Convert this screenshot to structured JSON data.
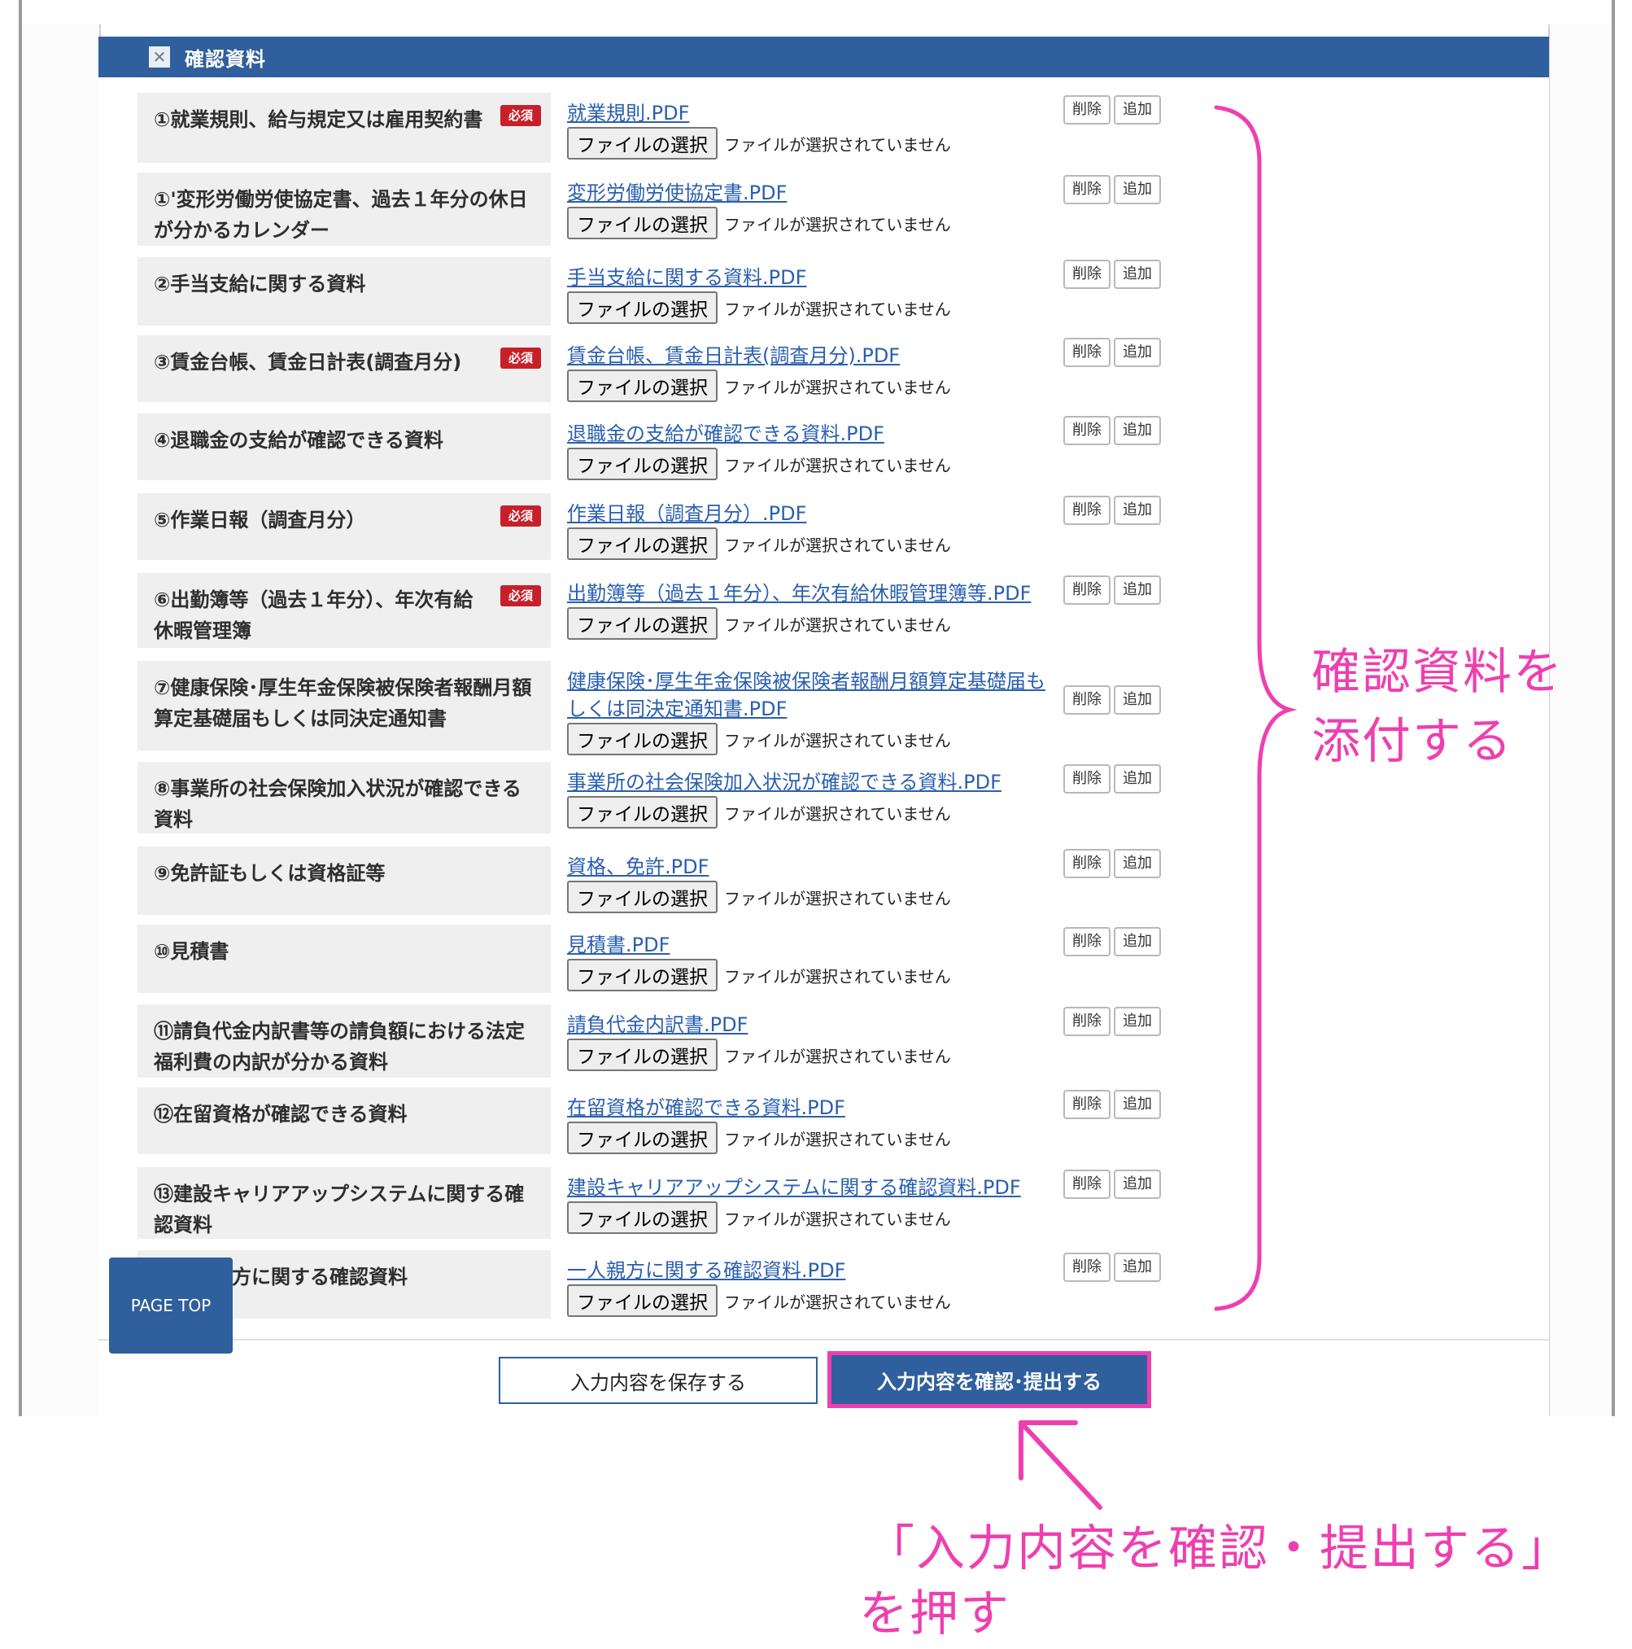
{
  "section": {
    "title": "確認資料",
    "icon": "close-icon"
  },
  "rows": [
    {
      "label": "①就業規則、給与規定又は雇用契約書",
      "required": true,
      "file": "就業規則.PDF"
    },
    {
      "label": "①'変形労働労使協定書、過去１年分の休日が分かるカレンダー",
      "required": false,
      "file": "変形労働労使協定書.PDF"
    },
    {
      "label": "②手当支給に関する資料",
      "required": false,
      "file": "手当支給に関する資料.PDF"
    },
    {
      "label": "③賃金台帳、賃金日計表(調査月分)",
      "required": true,
      "file": "賃金台帳、賃金日計表(調査月分).PDF"
    },
    {
      "label": "④退職金の支給が確認できる資料",
      "required": false,
      "file": "退職金の支給が確認できる資料.PDF"
    },
    {
      "label": "⑤作業日報（調査月分）",
      "required": true,
      "file": "作業日報（調査月分）.PDF"
    },
    {
      "label": "⑥出勤簿等（過去１年分）、年次有給休暇管理簿",
      "required": true,
      "file": "出勤簿等（過去１年分）、年次有給休暇管理簿等.PDF"
    },
    {
      "label": "⑦健康保険･厚生年金保険被保険者報酬月額算定基礎届もしくは同決定通知書",
      "required": false,
      "file": "健康保険･厚生年金保険被保険者報酬月額算定基礎届もしくは同決定通知書.PDF"
    },
    {
      "label": "⑧事業所の社会保険加入状況が確認できる資料",
      "required": false,
      "file": "事業所の社会保険加入状況が確認できる資料.PDF"
    },
    {
      "label": "⑨免許証もしくは資格証等",
      "required": false,
      "file": "資格、免許.PDF"
    },
    {
      "label": "⑩見積書",
      "required": false,
      "file": "見積書.PDF"
    },
    {
      "label": "⑪請負代金内訳書等の請負額における法定福利費の内訳が分かる資料",
      "required": false,
      "file": "請負代金内訳書.PDF"
    },
    {
      "label": "⑫在留資格が確認できる資料",
      "required": false,
      "file": "在留資格が確認できる資料.PDF"
    },
    {
      "label": "⑬建設キャリアアップシステムに関する確認資料",
      "required": false,
      "file": "建設キャリアアップシステムに関する確認資料.PDF"
    },
    {
      "label": "⑭一人親方に関する確認資料",
      "required": false,
      "file": "一人親方に関する確認資料.PDF"
    }
  ],
  "common": {
    "required_badge": "必須",
    "choose_file": "ファイルの選択",
    "no_file": "ファイルが選択されていません",
    "delete": "削除",
    "add": "追加"
  },
  "buttons": {
    "save": "入力内容を保存する",
    "submit": "入力内容を確認･提出する",
    "page_top": "PAGE TOP"
  },
  "annotations": {
    "brace_note_line1": "確認資料を",
    "brace_note_line2": "添付する",
    "submit_note_line1": "「入力内容を確認・提出する」",
    "submit_note_line2": "を押す",
    "color": "#ee3fb0"
  },
  "colors": {
    "header": "#2f5f9c",
    "link": "#2a5fb0",
    "badge": "#c8202a"
  }
}
